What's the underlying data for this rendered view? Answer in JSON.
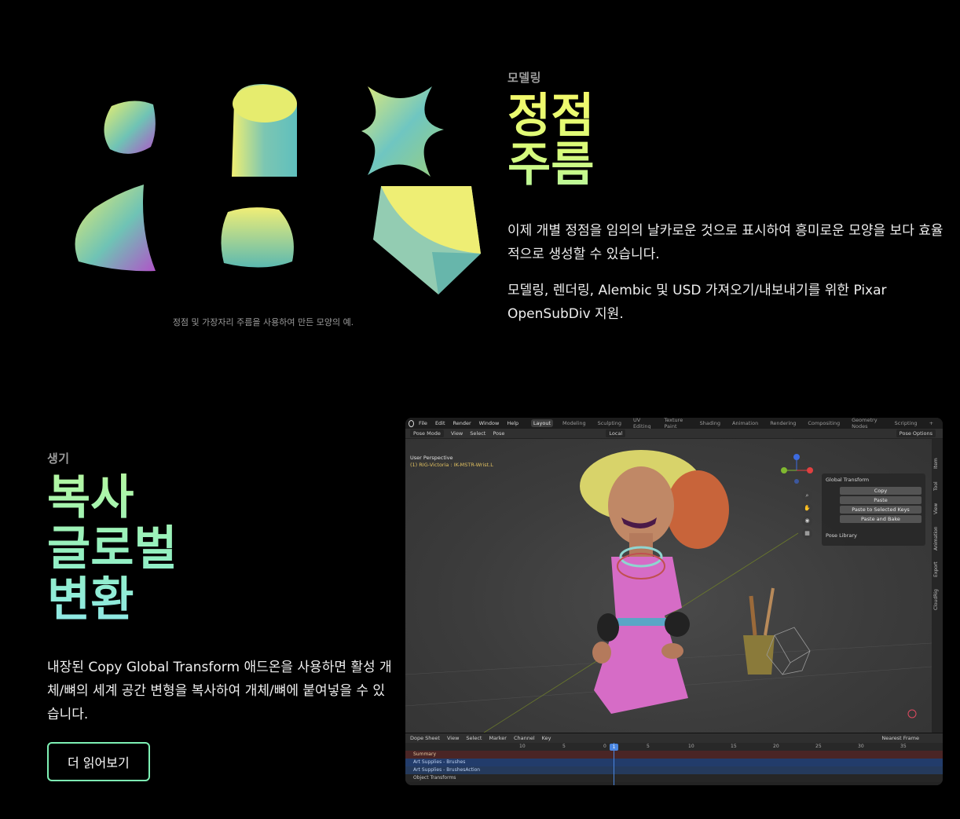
{
  "section1": {
    "eyebrow": "모델링",
    "title_lines": [
      "정점",
      "주름"
    ],
    "paragraph1": "이제 개별 정점을 임의의 날카로운 것으로 표시하여 흥미로운 모양을 보다 효율적으로 생성할 수 있습니다.",
    "paragraph2": "모델링, 렌더링, Alembic 및 USD 가져오기/내보내기를 위한 Pixar OpenSubDiv 지원.",
    "caption": "정점 및 가장자리 주름을 사용하여 만든 모양의 예."
  },
  "section2": {
    "eyebrow": "생기",
    "title_lines": [
      "복사",
      "글로벌",
      "변환"
    ],
    "paragraph": "내장된 Copy Global Transform 애드온을 사용하면 활성 개체/뼈의 세계 공간 변형을 복사하여 개체/뼈에 붙여넣을 수 있습니다.",
    "button_label": "더 읽어보기"
  },
  "blender": {
    "menu": [
      "File",
      "Edit",
      "Render",
      "Window",
      "Help"
    ],
    "workspaces": [
      "Layout",
      "Modeling",
      "Sculpting",
      "UV Editing",
      "Texture Paint",
      "Shading",
      "Animation",
      "Rendering",
      "Compositing",
      "Geometry Nodes",
      "Scripting"
    ],
    "active_workspace": "Layout",
    "header": {
      "mode": "Pose Mode",
      "view": "View",
      "select": "Select",
      "pose": "Pose",
      "orientation": "Local",
      "pose_options": "Pose Options"
    },
    "viewport": {
      "perspective": "User Perspective",
      "object": "(1) RIG-Victoria : IK-MSTR-Wrist.L"
    },
    "panel": {
      "title": "Global Transform",
      "buttons": [
        "Copy",
        "Paste",
        "Paste to Selected Keys",
        "Paste and Bake"
      ],
      "library": "Pose Library"
    },
    "side_tabs": [
      "Item",
      "Tool",
      "View",
      "Animation",
      "Export",
      "CloudRig"
    ],
    "dopesheet": {
      "editor": "Dope Sheet",
      "menus": [
        "View",
        "Select",
        "Marker",
        "Channel",
        "Key"
      ],
      "snap": "Nearest Frame",
      "current_frame": "1",
      "ruler": [
        "10",
        "5",
        "0",
        "5",
        "10",
        "15",
        "20",
        "25",
        "30",
        "35"
      ],
      "channels": [
        "Summary",
        "Art Supplies - Brushes",
        "Art Supplies - BrushesAction",
        "Object Transforms"
      ]
    }
  },
  "colors": {
    "title1_gradient": [
      "#f4f96a",
      "#b9f89a"
    ],
    "title2_gradient": [
      "#b4f7a1",
      "#8fe8e8"
    ],
    "button_border": "#7ef0b4"
  }
}
